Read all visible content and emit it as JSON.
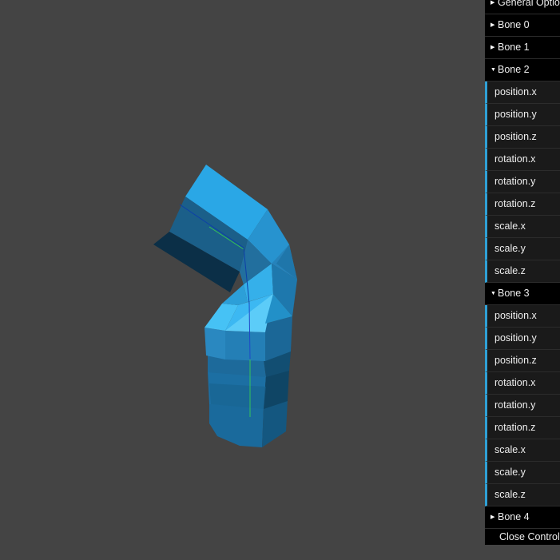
{
  "gui": {
    "general": "General Options",
    "bone0": "Bone 0",
    "bone1": "Bone 1",
    "bone2": {
      "title": "Bone 2",
      "controls": [
        "position.x",
        "position.y",
        "position.z",
        "rotation.x",
        "rotation.y",
        "rotation.z",
        "scale.x",
        "scale.y",
        "scale.z"
      ]
    },
    "bone3": {
      "title": "Bone 3",
      "controls": [
        "position.x",
        "position.y",
        "position.z",
        "rotation.x",
        "rotation.y",
        "rotation.z",
        "scale.x",
        "scale.y",
        "scale.z"
      ]
    },
    "bone4": "Bone 4",
    "close": "Close Controls",
    "icons": {
      "collapsed": "triangle-right-icon",
      "expanded": "triangle-down-icon"
    },
    "accent": "#2fa1d6"
  },
  "scene": {
    "background": "#444444",
    "mesh_color": "#29a6e6",
    "mesh_name": "skinned-cylinder-mesh"
  }
}
